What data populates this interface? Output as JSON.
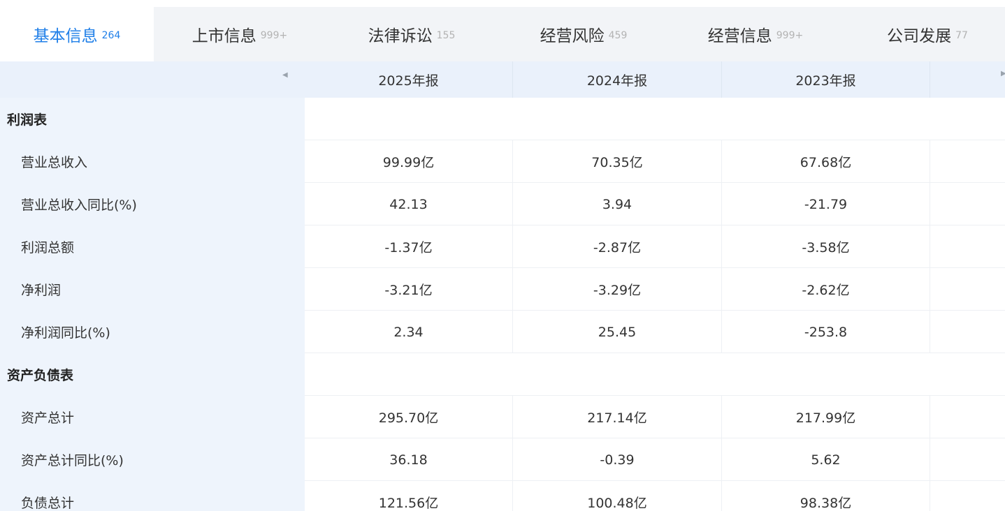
{
  "tabs": [
    {
      "label": "基本信息",
      "count": "264",
      "active": true
    },
    {
      "label": "上市信息",
      "count": "999+",
      "active": false
    },
    {
      "label": "法律诉讼",
      "count": "155",
      "active": false
    },
    {
      "label": "经营风险",
      "count": "459",
      "active": false
    },
    {
      "label": "经营信息",
      "count": "999+",
      "active": false
    },
    {
      "label": "公司发展",
      "count": "77",
      "active": false
    }
  ],
  "table": {
    "years": [
      "2025年报",
      "2024年报",
      "2023年报"
    ],
    "sections": {
      "income": "利润表",
      "balance": "资产负债表"
    },
    "rows": [
      {
        "label": "营业总收入",
        "values": [
          "99.99亿",
          "70.35亿",
          "67.68亿"
        ]
      },
      {
        "label": "营业总收入同比(%)",
        "values": [
          "42.13",
          "3.94",
          "-21.79"
        ]
      },
      {
        "label": "利润总额",
        "values": [
          "-1.37亿",
          "-2.87亿",
          "-3.58亿"
        ]
      },
      {
        "label": "净利润",
        "values": [
          "-3.21亿",
          "-3.29亿",
          "-2.62亿"
        ]
      },
      {
        "label": "净利润同比(%)",
        "values": [
          "2.34",
          "25.45",
          "-253.8"
        ]
      },
      {
        "label": "资产总计",
        "values": [
          "295.70亿",
          "217.14亿",
          "217.99亿"
        ]
      },
      {
        "label": "资产总计同比(%)",
        "values": [
          "36.18",
          "-0.39",
          "5.62"
        ]
      },
      {
        "label": "负债总计",
        "values": [
          "121.56亿",
          "100.48亿",
          "98.38亿"
        ]
      }
    ]
  },
  "colors": {
    "accent": "#1f7fe8",
    "label_panel": "#eef4fc",
    "tab_bar": "#f2f4f7"
  }
}
